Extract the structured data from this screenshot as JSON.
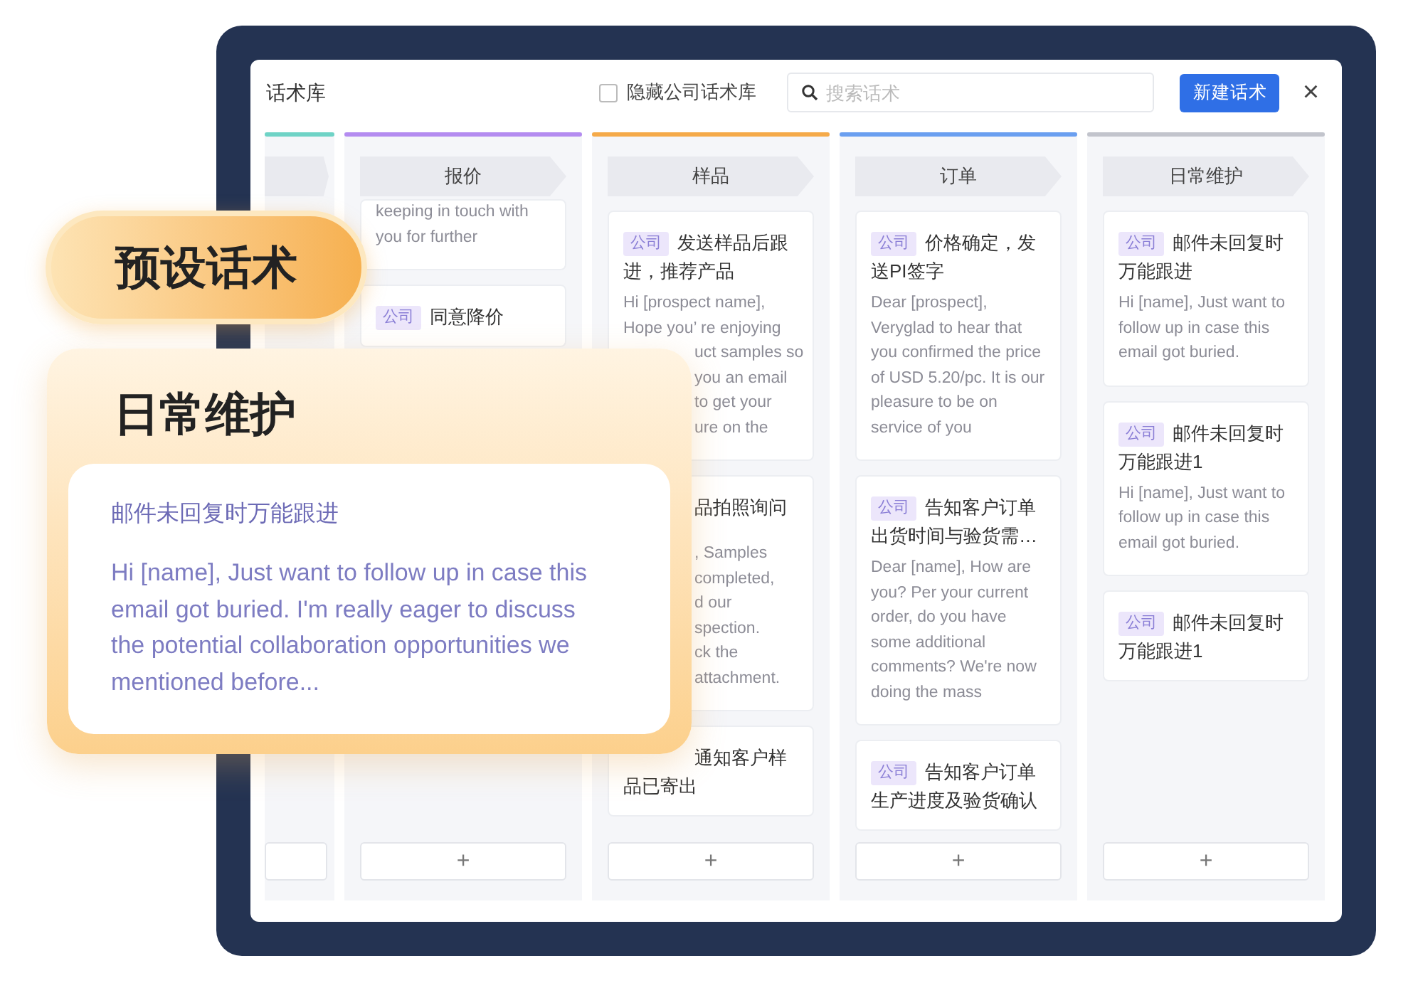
{
  "window": {
    "title": "话术库",
    "close": "×"
  },
  "hide_company": {
    "label": "隐藏公司话术库",
    "checked": false
  },
  "search": {
    "placeholder": "搜索话术"
  },
  "new_button": "新建话术",
  "columns": [
    {
      "kind": "partial",
      "color": "#6fd3c6"
    },
    {
      "kind": "full",
      "color": "#b48cf0",
      "title": "报价",
      "add": "+",
      "cards": [
        {
          "body": "keeping in touch with you for further"
        },
        {
          "tag": "公司",
          "title": "同意降价"
        }
      ]
    },
    {
      "kind": "full",
      "color": "#f5aa4a",
      "title": "样品",
      "add": "+",
      "cards": [
        {
          "tag": "公司",
          "title": "发送样品后跟进，推荐产品",
          "lines": [
            {
              "text": "Hi [prospect name],",
              "cut": false
            },
            {
              "text": "Hope you’ re enjoying",
              "cut": false
            },
            {
              "text": "uct samples so",
              "cut": true
            },
            {
              "text": "you an email",
              "cut": true
            },
            {
              "text": "to get your",
              "cut": true
            },
            {
              "text": "ure on the",
              "cut": true
            }
          ]
        },
        {
          "title": "品拍照询问",
          "title_cut": true,
          "lines": [
            {
              "text": ", Samples",
              "cut": true
            },
            {
              "text": "completed,",
              "cut": true
            },
            {
              "text": "d our",
              "cut": true
            },
            {
              "text": "spection.",
              "cut": true
            },
            {
              "text": "ck the",
              "cut": true
            },
            {
              "text": "attachment.",
              "cut": true
            }
          ]
        },
        {
          "title": "通知客户样品已寄出",
          "title_cut": true
        }
      ]
    },
    {
      "kind": "full",
      "color": "#6a9ff0",
      "title": "订单",
      "add": "+",
      "cards": [
        {
          "tag": "公司",
          "title": "价格确定，发送PI签字",
          "body": "Dear [prospect], Veryglad to hear that you confirmed the price of USD 5.20/pc. It is our pleasure to be on service of you"
        },
        {
          "tag": "公司",
          "title": "告知客户订单出货时间与验货需…",
          "body": "Dear [name], How are you? Per your current order, do you have some additional comments? We're now doing the mass"
        },
        {
          "tag": "公司",
          "title": "告知客户订单生产进度及验货确认"
        }
      ]
    },
    {
      "kind": "full",
      "color": "#c2c4cc",
      "title": "日常维护",
      "add": "+",
      "cards": [
        {
          "tag": "公司",
          "title": "邮件未回复时万能跟进",
          "body": "Hi [name], Just want to follow up in case this email got buried."
        },
        {
          "tag": "公司",
          "title": "邮件未回复时万能跟进1",
          "body": "Hi [name], Just want to follow up in case this email got buried."
        },
        {
          "tag": "公司",
          "title": "邮件未回复时万能跟进1"
        }
      ]
    }
  ],
  "badge": "预设话术",
  "feature": {
    "title": "日常维护",
    "card_title": "邮件未回复时万能跟进",
    "card_body": "Hi [name], Just want to follow up in case this email got buried. I'm really eager to discuss the potential collaboration opportunities we mentioned before..."
  }
}
